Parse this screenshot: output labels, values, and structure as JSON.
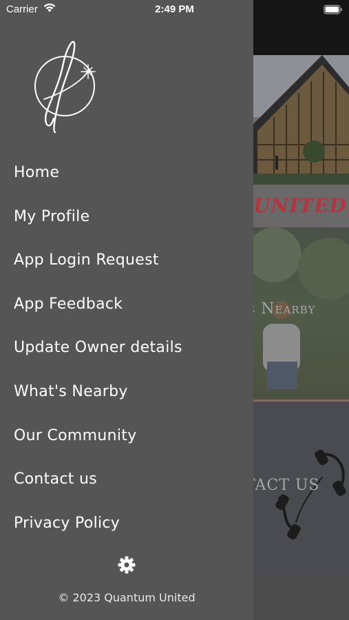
{
  "status_bar": {
    "carrier": "Carrier",
    "time": "2:49 PM"
  },
  "drawer": {
    "menu": [
      {
        "label": "Home"
      },
      {
        "label": "My Profile"
      },
      {
        "label": "App Login Request"
      },
      {
        "label": "App Feedback"
      },
      {
        "label": "Update Owner details"
      },
      {
        "label": "What's Nearby"
      },
      {
        "label": "Our Community"
      },
      {
        "label": "Contact us"
      },
      {
        "label": "Privacy Policy"
      }
    ],
    "settings_icon": "gear-icon",
    "copyright": "© 2023 Quantum United"
  },
  "background": {
    "banner_text": "UNITED",
    "tile_nearby": "s Nearby",
    "tile_contact": "TACT US"
  },
  "colors": {
    "drawer": "#555555",
    "text": "#ffffff",
    "brand_red": "#b5343e"
  }
}
